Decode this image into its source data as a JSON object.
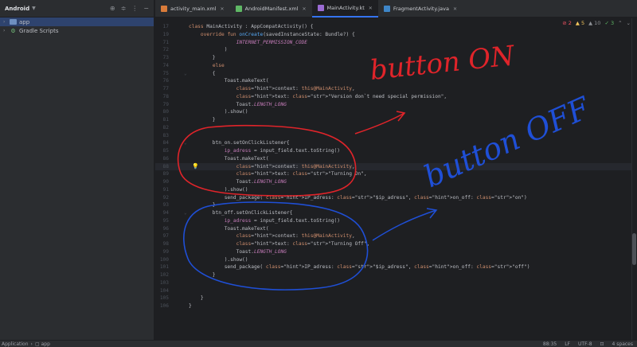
{
  "sidebar": {
    "title": "Android",
    "items": [
      {
        "label": "app",
        "selected": true
      },
      {
        "label": "Gradle Scripts",
        "selected": false
      }
    ]
  },
  "tabs": [
    {
      "label": "activity_main.xml",
      "color": "#d97b3a",
      "active": false
    },
    {
      "label": "AndroidManifest.xml",
      "color": "#5fb865",
      "active": false
    },
    {
      "label": "MainActivity.kt",
      "color": "#9b6bd4",
      "active": true
    },
    {
      "label": "FragmentActivity.java",
      "color": "#3e86c8",
      "active": false
    }
  ],
  "inspections": {
    "errors": "2",
    "warnings": "5",
    "weak": "10",
    "ok": "3"
  },
  "code_lines": [
    {
      "n": "17",
      "t": "class MainActivity : AppCompatActivity() {"
    },
    {
      "n": "19",
      "t": "    override fun onCreate(savedInstanceState: Bundle?) {"
    },
    {
      "n": "71",
      "t": "                INTERNET_PERMISSION_CODE"
    },
    {
      "n": "72",
      "t": "            )"
    },
    {
      "n": "73",
      "t": "        }"
    },
    {
      "n": "74",
      "t": "        else"
    },
    {
      "n": "75",
      "t": "        {"
    },
    {
      "n": "76",
      "t": "            Toast.makeText("
    },
    {
      "n": "77",
      "t": "                context: this@MainActivity,"
    },
    {
      "n": "78",
      "t": "                text: \"Version don`t need special permission\","
    },
    {
      "n": "79",
      "t": "                Toast.LENGTH_LONG"
    },
    {
      "n": "80",
      "t": "            ).show()"
    },
    {
      "n": "81",
      "t": "        }"
    },
    {
      "n": "82",
      "t": ""
    },
    {
      "n": "83",
      "t": ""
    },
    {
      "n": "84",
      "t": "        btn_on.setOnClickListener{"
    },
    {
      "n": "85",
      "t": "            ip_adress = input_field.text.toString()"
    },
    {
      "n": "86",
      "t": "            Toast.makeText("
    },
    {
      "n": "88",
      "t": "                context: this@MainActivity,"
    },
    {
      "n": "89",
      "t": "                text: \"Turning On\","
    },
    {
      "n": "90",
      "t": "                Toast.LENGTH_LONG"
    },
    {
      "n": "91",
      "t": "            ).show()"
    },
    {
      "n": "92",
      "t": "            send_package( IP_adress: \"$ip_adress\", on_off: \"on\")"
    },
    {
      "n": "93",
      "t": "        }"
    },
    {
      "n": "94",
      "t": "        btn_off.setOnClickListener{"
    },
    {
      "n": "95",
      "t": "            ip_adress = input_field.text.toString()"
    },
    {
      "n": "96",
      "t": "            Toast.makeText("
    },
    {
      "n": "97",
      "t": "                context: this@MainActivity,"
    },
    {
      "n": "98",
      "t": "                text: \"Turning Off\","
    },
    {
      "n": "99",
      "t": "                Toast.LENGTH_LONG"
    },
    {
      "n": "100",
      "t": "            ).show()"
    },
    {
      "n": "101",
      "t": "            send_package( IP_adress: \"$ip_adress\", on_off: \"off\")"
    },
    {
      "n": "102",
      "t": "        }"
    },
    {
      "n": "103",
      "t": ""
    },
    {
      "n": "104",
      "t": ""
    },
    {
      "n": "105",
      "t": "    }"
    },
    {
      "n": "106",
      "t": "}"
    }
  ],
  "annotations": {
    "on_label": "button ON",
    "off_label": "button OFF",
    "on_color": "#e0242a",
    "off_color": "#1f4fd6"
  },
  "statusbar": {
    "left": "Application",
    "module": "app",
    "position": "88:35",
    "line_ending": "LF",
    "encoding": "UTF-8",
    "indent": "4 spaces"
  }
}
